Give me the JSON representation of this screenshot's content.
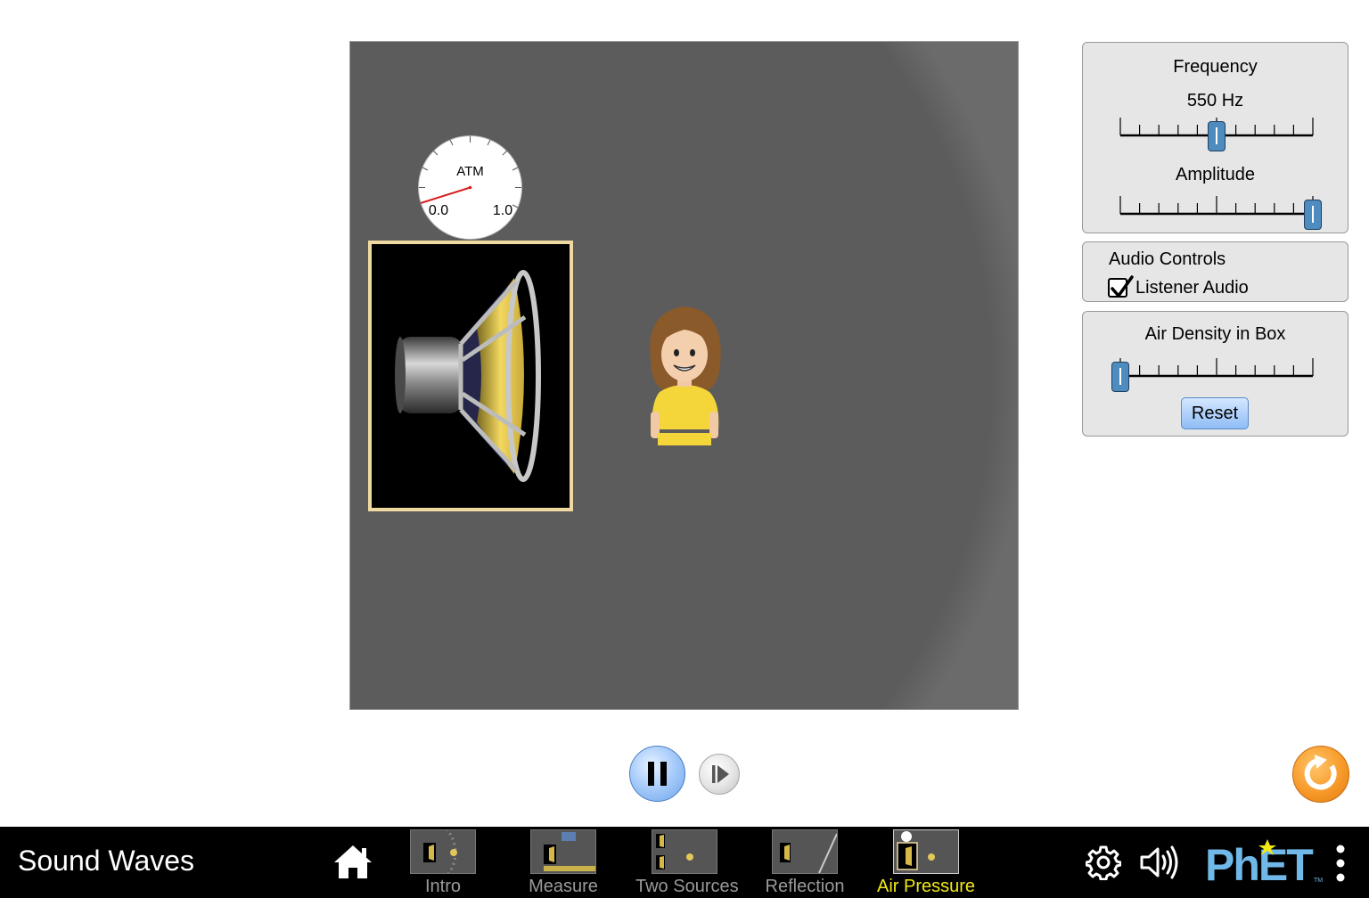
{
  "gauge": {
    "label": "ATM",
    "min_label": "0.0",
    "max_label": "1.0"
  },
  "controls": {
    "frequency": {
      "title": "Frequency",
      "value_text": "550 Hz",
      "level": 0.5
    },
    "amplitude": {
      "title": "Amplitude",
      "level": 1.0
    },
    "audio": {
      "title": "Audio Controls",
      "listener_audio_label": "Listener Audio",
      "listener_audio_checked": true
    },
    "air_density": {
      "title": "Air Density in Box",
      "level": 0.0,
      "reset_label": "Reset"
    }
  },
  "playback": {
    "state": "playing"
  },
  "navbar": {
    "app_title": "Sound Waves",
    "screens": [
      {
        "label": "Intro",
        "active": false
      },
      {
        "label": "Measure",
        "active": false
      },
      {
        "label": "Two Sources",
        "active": false
      },
      {
        "label": "Reflection",
        "active": false
      },
      {
        "label": "Air Pressure",
        "active": true
      }
    ],
    "logo_text": "PhET"
  },
  "colors": {
    "active_screen": "#f2e916",
    "slider_thumb": "#4e8cbf",
    "pressure_needle": "#d62020",
    "speaker_frame": "#f0d9a0",
    "reset_all": "#f79a2a"
  }
}
